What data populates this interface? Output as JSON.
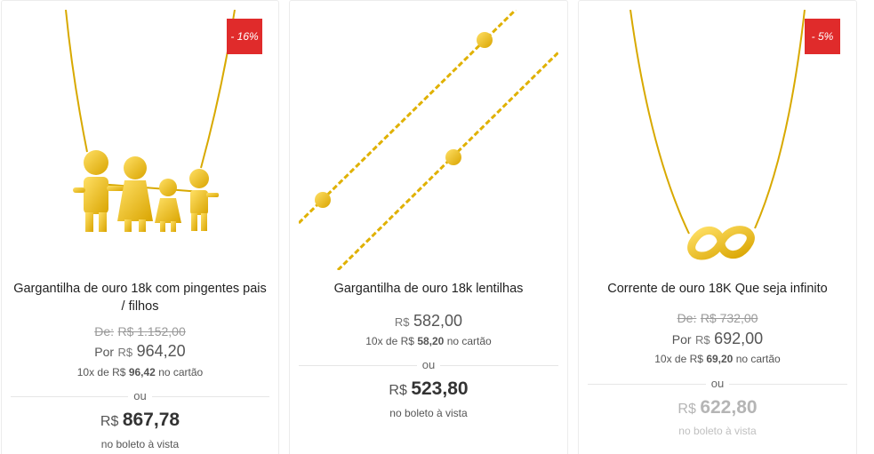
{
  "products": [
    {
      "title": "Gargantilha de ouro 18k com pingentes pais / filhos",
      "badge": "- 16%",
      "old_price_label": "De:",
      "old_price": "R$ 1.152,00",
      "por_label": "Por",
      "currency": "R$",
      "price": "964,20",
      "installments_prefix": "10x de",
      "installment_value": "96,42",
      "installments_suffix": "no cartão",
      "ou": "ou",
      "boleto_price": "867,78",
      "boleto_label": "no boleto à vista"
    },
    {
      "title": "Gargantilha de ouro 18k lentilhas",
      "currency": "R$",
      "price": "582,00",
      "installments_prefix": "10x de",
      "installment_value": "58,20",
      "installments_suffix": "no cartão",
      "ou": "ou",
      "boleto_price": "523,80",
      "boleto_label": "no boleto à vista"
    },
    {
      "title": "Corrente de ouro 18K Que seja infinito",
      "badge": "- 5%",
      "old_price_label": "De:",
      "old_price": "R$ 732,00",
      "por_label": "Por",
      "currency": "R$",
      "price": "692,00",
      "installments_prefix": "10x de",
      "installment_value": "69,20",
      "installments_suffix": "no cartão",
      "ou": "ou",
      "boleto_price": "622,80",
      "boleto_label": "no boleto à vista"
    }
  ],
  "colors": {
    "badge": "#e02b2b",
    "gold": "#f2c200",
    "gold_dark": "#c99700"
  }
}
